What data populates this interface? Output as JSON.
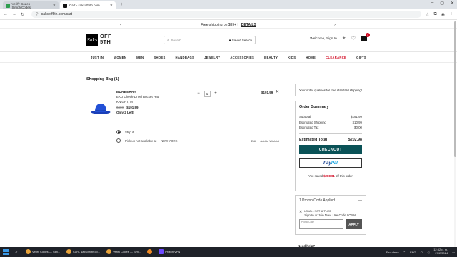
{
  "browser": {
    "tabs": [
      {
        "title": "Verify Codes — SimplyCodes",
        "active": false,
        "fav_color": "#2e9d4f"
      },
      {
        "title": "Cart - saksoff5th.com",
        "active": true,
        "fav_color": "#111111"
      }
    ],
    "url": "saksoff5th.com/cart"
  },
  "promo_bar": {
    "text": "Free shipping on $99+ |",
    "link": "DETAILS"
  },
  "header": {
    "logo_mark": "Saks",
    "logo_line1": "OFF",
    "logo_line2": "5TH",
    "search_placeholder": "Search",
    "saved_search": "Saved Search",
    "greeting": "Welcome, Sign In",
    "bag_count": "1"
  },
  "nav": [
    "JUST IN",
    "WOMEN",
    "MEN",
    "SHOES",
    "HANDBAGS",
    "JEWELRY",
    "ACCESSORIES",
    "BEAUTY",
    "KIDS",
    "HOME",
    "CLEARANCE",
    "GIFTS"
  ],
  "bag": {
    "title": "Shopping Bag (1)",
    "item": {
      "brand": "BURBERRY",
      "name": "EKD Check-Lined Bucket Hat",
      "color": "KNIGHT, M",
      "orig_price": "$480",
      "sale_price": "$191.99",
      "stock": "Only 2 Left!",
      "qty": "1",
      "line_price": "$191.99",
      "ship_label": "Ship it",
      "pickup_label": "Pick up not available at",
      "pickup_store": "NEW YORK",
      "edit": "Edit",
      "wishlist": "Add to Wishlist"
    }
  },
  "free_ship_msg": "Your order qualifies for free standard shipping!",
  "summary": {
    "title": "Order Summary",
    "rows": [
      {
        "label": "Subtotal",
        "value": "$191.99"
      },
      {
        "label": "Estimated Shipping",
        "value": "$10.99"
      },
      {
        "label": "Estimated Tax",
        "value": "$0.00"
      }
    ],
    "total_label": "Estimated Total",
    "total_value": "$202.98",
    "checkout": "CHECKOUT",
    "paypal_1": "Pay",
    "paypal_2": "Pal",
    "saved_prefix": "You saved",
    "saved_amount": "$288.01",
    "saved_suffix": "off this order"
  },
  "promo_code": {
    "header": "1 Promo Code Applied",
    "code_status": "LOYAL - NOT APPLIED",
    "code_desc": "Sign In or Join Now. Use Code LOYAL",
    "input_label": "Promo Code",
    "apply": "APPLY"
  },
  "need_help": "Need help?",
  "taskbar": {
    "items": [
      {
        "label": "Verify Codes — Sim...",
        "color": "#e8a33a"
      },
      {
        "label": "Cart - saksoff5th.co...",
        "color": "#e8a33a"
      },
      {
        "label": "Verify Codes — Sim...",
        "color": "#e8a33a"
      },
      {
        "label": "",
        "color": "#f08a24"
      },
      {
        "label": "Proton VPN",
        "color": "#6d4aff"
      }
    ],
    "lang": "ENG",
    "region": "Escudeiro",
    "time": "12:52 p. m.",
    "date": "27/2/2024"
  },
  "colors": {
    "accent": "#0a5257",
    "sale": "#d0021b"
  }
}
